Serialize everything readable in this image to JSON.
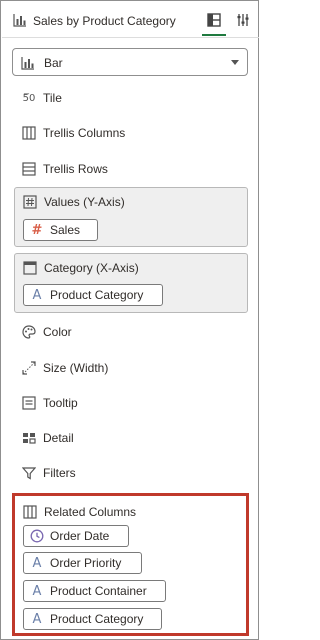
{
  "header": {
    "title": "Sales by Product Category"
  },
  "visualization_type": {
    "selected": "Bar"
  },
  "sections": {
    "tile": "Tile",
    "trellis_columns": "Trellis Columns",
    "trellis_rows": "Trellis Rows",
    "values": {
      "title": "Values (Y-Axis)",
      "items": [
        "Sales"
      ]
    },
    "category": {
      "title": "Category (X-Axis)",
      "items": [
        "Product Category"
      ]
    },
    "color": "Color",
    "size": "Size (Width)",
    "tooltip": "Tooltip",
    "detail": "Detail",
    "filters": "Filters",
    "related": {
      "title": "Related Columns",
      "items": [
        "Order Date",
        "Order Priority",
        "Product Container",
        "Product Category"
      ]
    }
  },
  "colors": {
    "highlight_border": "#c0392b",
    "active_tab": "#1f7a3f",
    "measure_icon": "#d9604a",
    "attribute_icon": "#6a7fa8",
    "date_icon": "#7a68b0"
  },
  "icons": [
    "bar-chart-icon",
    "layout-icon",
    "sliders-icon",
    "tile-icon",
    "trellis-columns-icon",
    "trellis-rows-icon",
    "hash-icon",
    "category-icon",
    "palette-icon",
    "resize-icon",
    "tooltip-icon",
    "detail-icon",
    "filter-icon",
    "columns-icon",
    "clock-icon",
    "attribute-icon"
  ]
}
